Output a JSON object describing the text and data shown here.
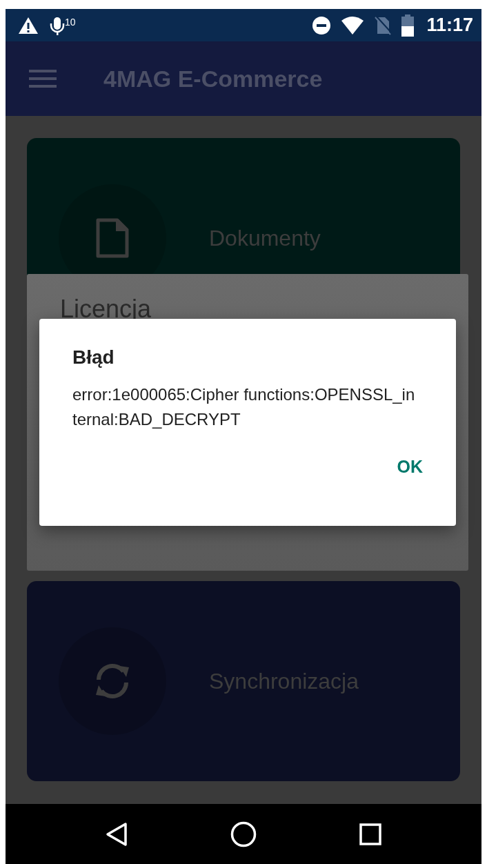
{
  "status_bar": {
    "notification_count": "10",
    "time": "11:17"
  },
  "app_bar": {
    "title": "4MAG E-Commerce"
  },
  "cards": [
    {
      "label": "Dokumenty",
      "kind": "document",
      "color": "#001a17"
    },
    {
      "label": "Synchronizacja",
      "kind": "sync",
      "color": "#0c0f24"
    }
  ],
  "background_dialog": {
    "title": "Licencja"
  },
  "error_dialog": {
    "title": "Błąd",
    "message": "error:1e000065:Cipher functions:OPENSSL_internal:BAD_DECRYPT",
    "button": "OK"
  }
}
